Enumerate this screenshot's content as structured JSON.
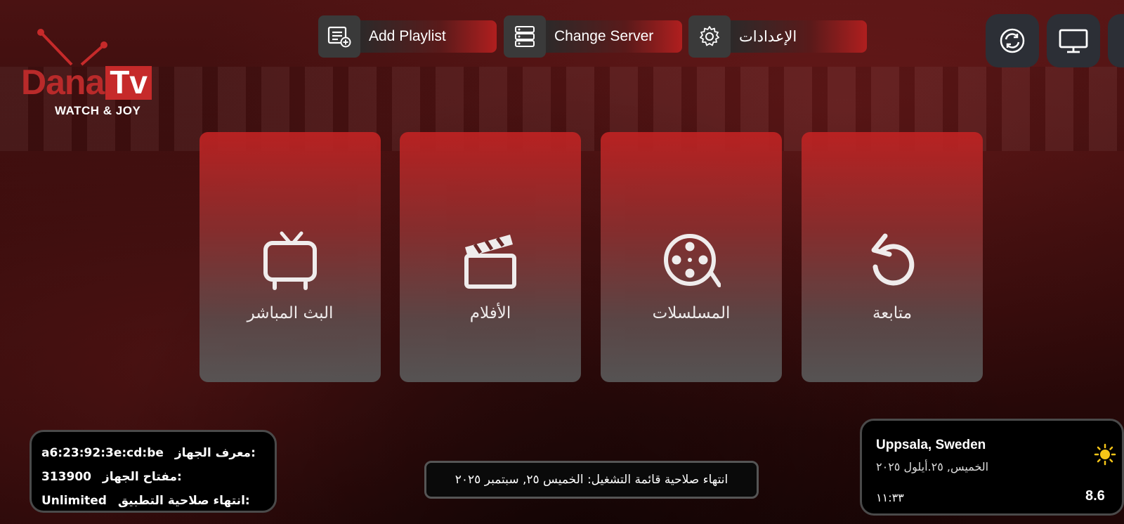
{
  "logo": {
    "brand_main": "Dana",
    "brand_tv": "Tv",
    "tagline": "WATCH & JOY"
  },
  "toolbar": {
    "add_playlist": "Add Playlist",
    "change_server": "Change Server",
    "settings": "الإعدادات"
  },
  "tiles": [
    {
      "label": "البث المباشر",
      "icon": "tv-icon"
    },
    {
      "label": "الأفلام",
      "icon": "clapperboard-icon"
    },
    {
      "label": "المسلسلات",
      "icon": "film-reel-icon"
    },
    {
      "label": "متابعة",
      "icon": "replay-icon"
    }
  ],
  "device": {
    "id_label": "معرف الجهاز:",
    "id_value": "a6:23:92:3e:cd:be",
    "key_label": "مفتاح الجهاز:",
    "key_value": "313900",
    "expiry_label": "انتهاء صلاحية التطبيق:",
    "expiry_value": "Unlimited"
  },
  "playlist_expiry": "انتهاء صلاحية قائمة التشغيل: الخميس ٢٥, سبتمبر ٢٠٢٥",
  "weather": {
    "city": "Uppsala, Sweden",
    "date": "الخميس, ٢٥.أيلول ٢٠٢٥",
    "time": "١١:٣٣",
    "temperature": "8.6",
    "icon": "sun-icon"
  },
  "colors": {
    "accent": "#c62a2a",
    "panel": "#000000"
  }
}
